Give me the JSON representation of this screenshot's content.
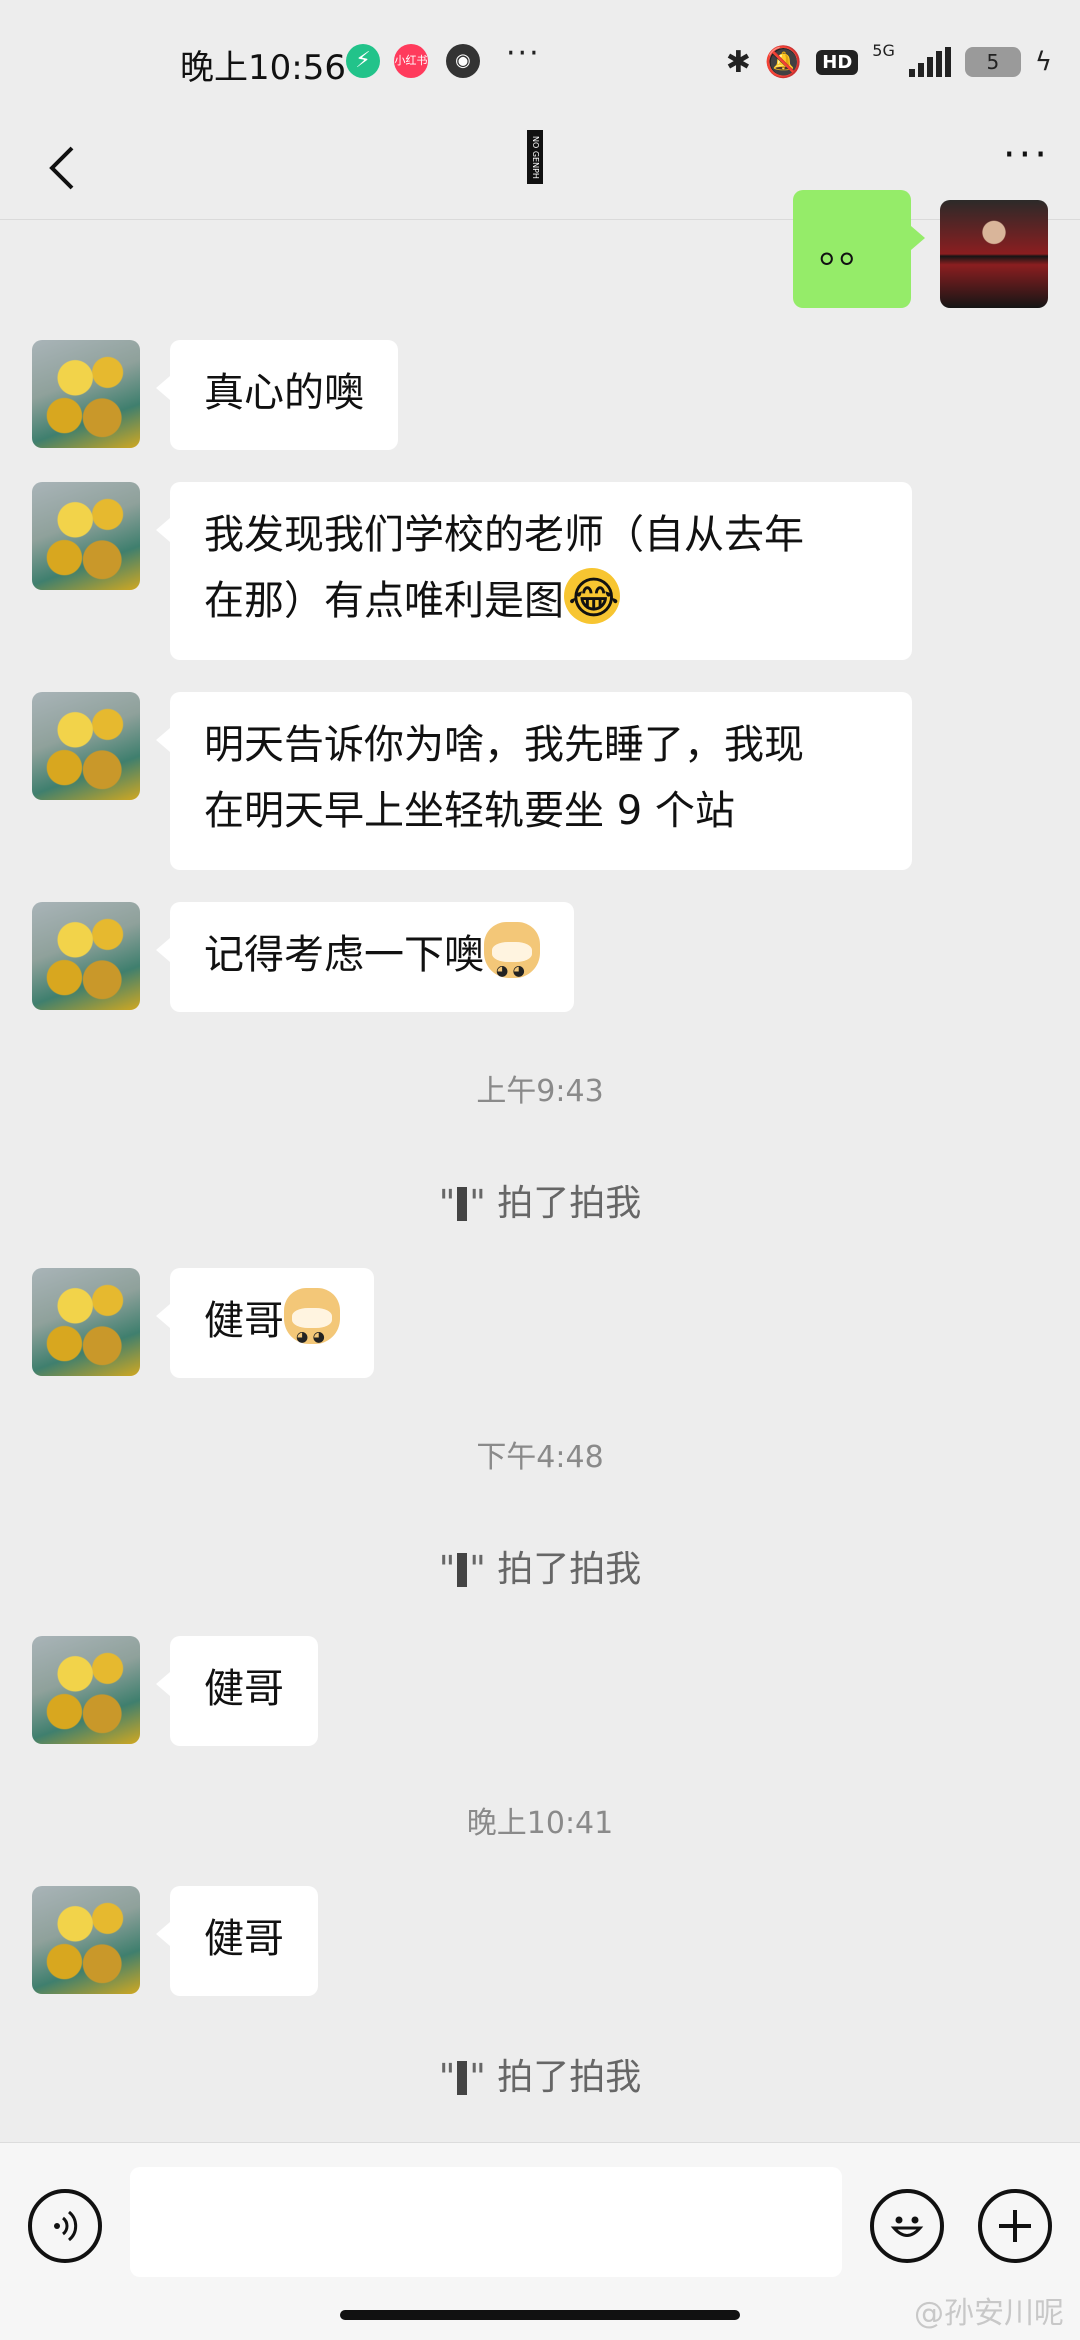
{
  "status_bar": {
    "time": "晚上10:56",
    "network": "5G",
    "hd": "HD",
    "battery": "5",
    "more": "···",
    "xhs_label": "小红书"
  },
  "header": {
    "title": "NO GENPH",
    "more": "···"
  },
  "messages": {
    "m0": {
      "text": "。。",
      "sender": "me"
    },
    "m1": {
      "text": "真心的噢"
    },
    "m2": {
      "line1": "我发现我们学校的老师（自从去年",
      "line2": "在那）有点唯利是图"
    },
    "m3": {
      "line1": "明天告诉你为啥，我先睡了，我现",
      "line2": "在明天早上坐轻轨要坐 9 个站"
    },
    "m4": {
      "text": "记得考虑一下噢"
    },
    "t1": "上午9:43",
    "p1": {
      "open": "\"",
      "close": "\" 拍了拍我"
    },
    "m5": {
      "text": "健哥"
    },
    "t2": "下午4:48",
    "p2": {
      "open": "\"",
      "close": "\" 拍了拍我"
    },
    "m6": {
      "text": "健哥"
    },
    "t3": "晚上10:41",
    "m7": {
      "text": "健哥"
    },
    "p3": {
      "open": "\"",
      "close": "\" 拍了拍我"
    }
  },
  "input": {
    "value": "",
    "placeholder": ""
  },
  "watermark": "@孙安川呢",
  "icons": {
    "back": "chevron-left-icon",
    "voice": "voice-icon",
    "emoji": "smile-icon",
    "add": "plus-icon"
  }
}
